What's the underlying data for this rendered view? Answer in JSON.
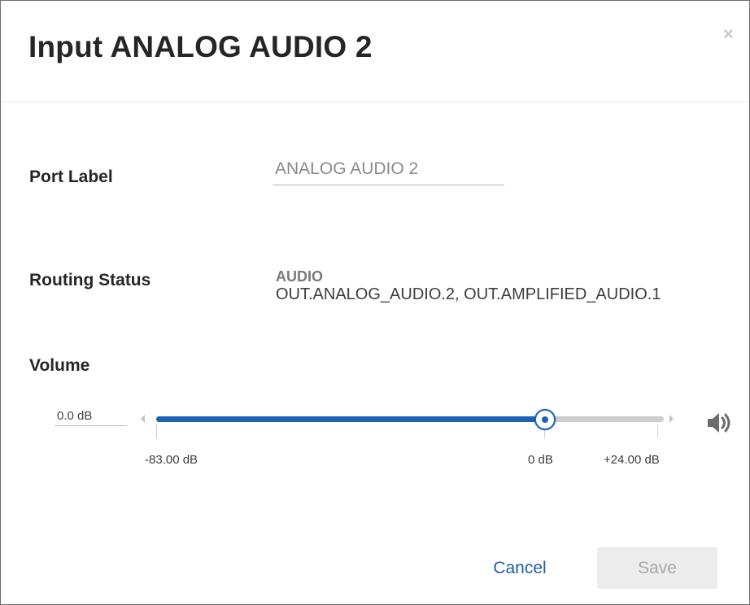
{
  "dialog": {
    "title": "Input ANALOG AUDIO 2",
    "close_glyph": "×"
  },
  "port_label": {
    "label": "Port Label",
    "value": "ANALOG AUDIO 2"
  },
  "routing_status": {
    "label": "Routing Status",
    "type": "AUDIO",
    "outputs": "OUT.ANALOG_AUDIO.2, OUT.AMPLIFIED_AUDIO.1"
  },
  "volume": {
    "label": "Volume",
    "value_text": "0.0 dB",
    "value_db": 0.0,
    "min_db": -83.0,
    "max_db": 24.0,
    "ticks": [
      {
        "db": -83.0,
        "label": "-83.00 dB"
      },
      {
        "db": 0.0,
        "label": "0 dB"
      },
      {
        "db": 24.0,
        "label": "+24.00 dB"
      }
    ],
    "speaker_icon": "speaker-icon",
    "accent_color": "#1d63b3"
  },
  "footer": {
    "cancel_label": "Cancel",
    "save_label": "Save"
  }
}
